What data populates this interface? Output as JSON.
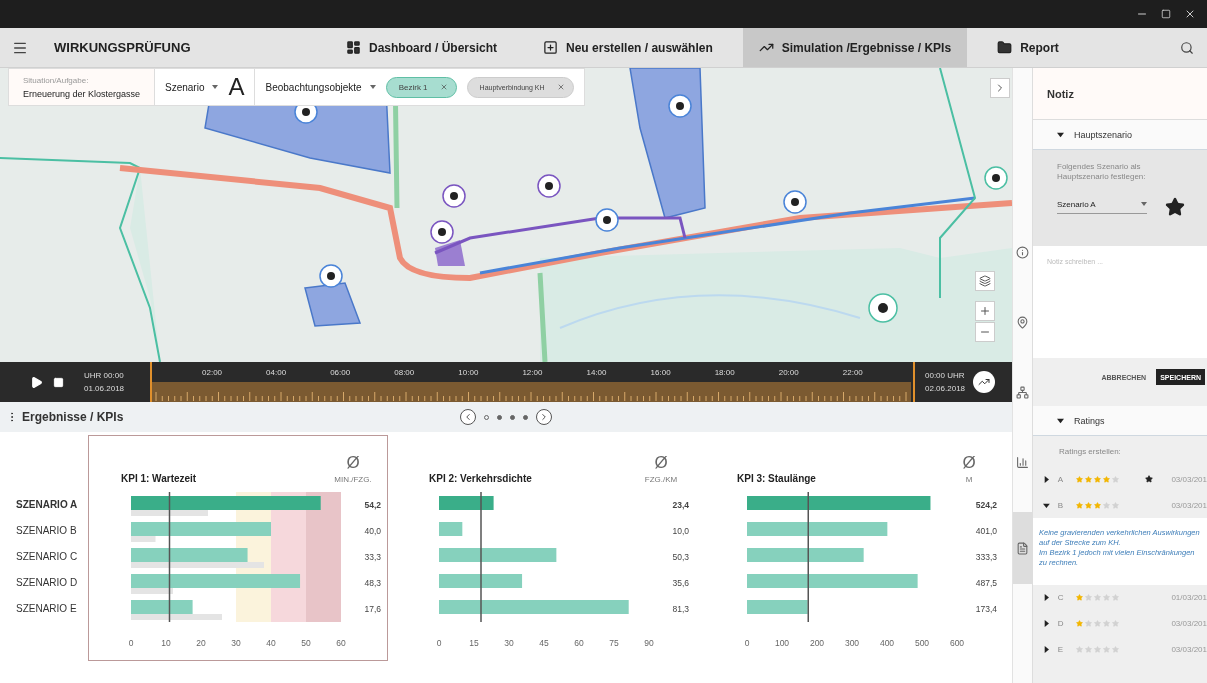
{
  "nav": {
    "title": "WIRKUNGSPRÜFUNG",
    "tabs": [
      {
        "label": "Dashboard / Übersicht",
        "kind": "dashboard",
        "selected": false
      },
      {
        "label": "Neu erstellen / auswählen",
        "kind": "create",
        "selected": false
      },
      {
        "label": "Simulation /Ergebnisse / KPIs",
        "kind": "simulation",
        "selected": true
      },
      {
        "label": "Report",
        "kind": "report",
        "selected": false
      }
    ]
  },
  "filters": {
    "task_label": "Situation/Aufgabe:",
    "task": "Erneuerung der Klostergasse",
    "scenario_label": "Szenario",
    "scenario_value": "A",
    "objects_label": "Beobachtungsobjekte",
    "chips": [
      {
        "label": "Bezirk 1",
        "selected": true
      },
      {
        "label": "Hauptverbindung KH",
        "selected": false
      }
    ]
  },
  "timeline": {
    "start_time": "UHR 00:00",
    "start_date": "01.06.2018",
    "hours": [
      "02:00",
      "04:00",
      "06:00",
      "08:00",
      "10:00",
      "12:00",
      "14:00",
      "16:00",
      "18:00",
      "20:00",
      "22:00"
    ],
    "end_time": "00:00 UHR",
    "end_date": "02.06.2018"
  },
  "results": {
    "title": "Ergebnisse / KPIs",
    "pages": [
      {
        "selected": true
      },
      {
        "selected": false
      },
      {
        "selected": false
      },
      {
        "selected": false
      }
    ],
    "scenarios": [
      {
        "label": "SZENARIO A",
        "selected": true
      },
      {
        "label": "SZENARIO B",
        "selected": false
      },
      {
        "label": "SZENARIO C",
        "selected": false
      },
      {
        "label": "SZENARIO D",
        "selected": false
      },
      {
        "label": "SZENARIO E",
        "selected": false
      }
    ],
    "kpis": [
      {
        "selected": true,
        "avg_symbol": "Ø",
        "unit": "MIN./FZG.",
        "chart_data": {
          "type": "bar",
          "orientation": "horizontal",
          "title": "KPI 1: Wartezeit",
          "series": [
            {
              "color": "#3aae89",
              "values": [
                54.2,
                null,
                null,
                null,
                null
              ]
            },
            {
              "color": "#86d1bd",
              "values": [
                null,
                40.0,
                33.3,
                48.3,
                17.6
              ]
            },
            {
              "color": "#e4e4e4",
              "values": [
                22,
                7,
                38,
                12,
                26
              ]
            }
          ],
          "xlim": [
            0,
            60
          ],
          "xticks": [
            0,
            10,
            20,
            30,
            40,
            50,
            60
          ],
          "value_labels": [
            "54,2",
            "40,0",
            "33,3",
            "48,3",
            "17,6"
          ],
          "bands": [
            {
              "axis": "x",
              "from": 30,
              "to": 40,
              "color": "#fbf3dc"
            },
            {
              "axis": "x",
              "from": 40,
              "to": 50,
              "color": "#f6d8dc"
            },
            {
              "axis": "x",
              "from": 50,
              "to": 60,
              "color": "#e8c4c8"
            }
          ],
          "ref_lines": [
            {
              "axis": "x",
              "value": 11
            }
          ]
        }
      },
      {
        "selected": false,
        "avg_symbol": "Ø",
        "unit": "FZG./KM",
        "chart_data": {
          "type": "bar",
          "orientation": "horizontal",
          "title": "KPI 2: Verkehrsdichte",
          "series": [
            {
              "color": "#3aae89",
              "values": [
                23.4,
                null,
                null,
                null,
                null
              ]
            },
            {
              "color": "#86d1bd",
              "values": [
                null,
                10.0,
                50.3,
                35.6,
                81.3
              ]
            }
          ],
          "xlim": [
            0,
            90
          ],
          "xticks": [
            0,
            15,
            30,
            45,
            60,
            75,
            90
          ],
          "value_labels": [
            "23,4",
            "10,0",
            "50,3",
            "35,6",
            "81,3"
          ],
          "ref_lines": [
            {
              "axis": "x",
              "value": 18
            }
          ]
        }
      },
      {
        "selected": false,
        "avg_symbol": "Ø",
        "unit": "M",
        "chart_data": {
          "type": "bar",
          "orientation": "horizontal",
          "title": "KPI 3: Staulänge",
          "series": [
            {
              "color": "#3aae89",
              "values": [
                524.2,
                null,
                null,
                null,
                null
              ]
            },
            {
              "color": "#86d1bd",
              "values": [
                null,
                401.0,
                333.3,
                487.5,
                173.4
              ]
            }
          ],
          "xlim": [
            0,
            600
          ],
          "xticks": [
            0,
            100,
            200,
            300,
            400,
            500,
            600
          ],
          "value_labels": [
            "524,2",
            "401,0",
            "333,3",
            "487,5",
            "173,4"
          ],
          "ref_lines": [
            {
              "axis": "x",
              "value": 175
            }
          ]
        }
      }
    ]
  },
  "side_tools": [
    {
      "kind": "info",
      "selected": false
    },
    {
      "kind": "pin",
      "selected": false
    },
    {
      "kind": "network",
      "selected": false
    },
    {
      "kind": "chart",
      "selected": false
    },
    {
      "kind": "document",
      "selected": true
    }
  ],
  "panel": {
    "title": "Notiz",
    "main_scenario": {
      "title": "Hauptszenario",
      "expanded": true,
      "hint": "Folgendes Szenario als Hauptszenario festlegen:",
      "value": "Szenario A"
    },
    "note": {
      "placeholder": "Notiz schreiben ..."
    },
    "buttons": [
      {
        "label": "ABBRECHEN",
        "kind": "text"
      },
      {
        "label": "SPEICHERN",
        "kind": "primary"
      }
    ],
    "ratings": {
      "title": "Ratings",
      "expanded": true,
      "hint": "Ratings erstellen:",
      "rows": [
        {
          "label": "A",
          "stars": 4,
          "main": true,
          "date": "03/03/201",
          "expanded": false
        },
        {
          "label": "B",
          "stars": 3,
          "main": false,
          "date": "03/03/201",
          "expanded": true,
          "comment": "Keine gravierenden verkehrlichen Auswirkungen auf der Strecke zum KH.\nIm Bezirk 1 jedoch mit vielen Einschränkungen zu rechnen."
        },
        {
          "label": "C",
          "stars": 1,
          "main": false,
          "date": "01/03/201",
          "expanded": false
        },
        {
          "label": "D",
          "stars": 1,
          "main": false,
          "date": "03/03/201",
          "expanded": false
        },
        {
          "label": "E",
          "stars": 0,
          "main": false,
          "date": "03/03/201",
          "expanded": false
        }
      ]
    }
  }
}
